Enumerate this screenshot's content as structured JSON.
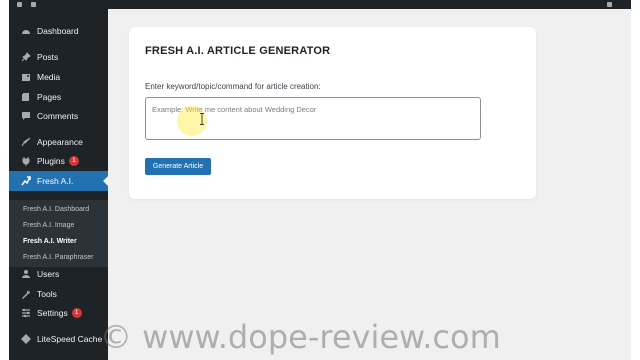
{
  "sidebar": {
    "items": [
      {
        "label": "Dashboard",
        "icon": "dashboard-icon"
      },
      {
        "label": "Posts",
        "icon": "pin-icon"
      },
      {
        "label": "Media",
        "icon": "media-icon"
      },
      {
        "label": "Pages",
        "icon": "pages-icon"
      },
      {
        "label": "Comments",
        "icon": "comment-icon"
      },
      {
        "label": "Appearance",
        "icon": "brush-icon"
      },
      {
        "label": "Plugins",
        "icon": "plugin-icon",
        "badge": "1"
      },
      {
        "label": "Fresh A.I.",
        "icon": "ai-icon",
        "active": true
      },
      {
        "label": "Users",
        "icon": "users-icon"
      },
      {
        "label": "Tools",
        "icon": "wrench-icon"
      },
      {
        "label": "Settings",
        "icon": "settings-icon",
        "badge": "1"
      },
      {
        "label": "LiteSpeed Cache",
        "icon": "litespeed-icon"
      }
    ],
    "submenu": [
      {
        "label": "Fresh A.I. Dashboard"
      },
      {
        "label": "Fresh A.I. Image"
      },
      {
        "label": "Fresh A.I. Writer",
        "current": true
      },
      {
        "label": "Fresh A.I. Paraphraser"
      }
    ]
  },
  "main": {
    "title": "FRESH A.I. ARTICLE GENERATOR",
    "prompt_label": "Enter keyword/topic/command for article creation:",
    "prompt_placeholder": "Example: Write me content about Wedding Decor",
    "generate_button": "Generate Article"
  },
  "watermark": "© www.dope-review.com",
  "colors": {
    "sidebar_bg": "#1d2327",
    "accent": "#2271b1",
    "badge": "#d63638",
    "page_bg": "#f0f0f1"
  }
}
